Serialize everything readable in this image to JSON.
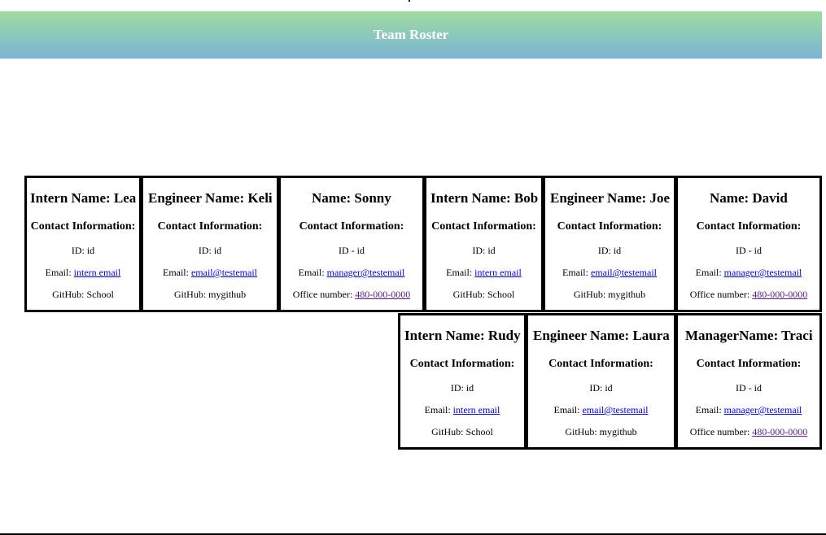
{
  "header": {
    "title": "Team Roster"
  },
  "cards": [
    {
      "title": "Intern Name: Lea",
      "contact_heading": "Contact Information:",
      "id_line": "ID: id",
      "email_label": "Email: ",
      "email_link": "intern email",
      "third_label": "GitHub: School",
      "third_link": ""
    },
    {
      "title": "Engineer Name: Keli",
      "contact_heading": "Contact Information:",
      "id_line": "ID: id",
      "email_label": "Email: ",
      "email_link": "email@testemail",
      "third_label": "GitHub: mygithub",
      "third_link": ""
    },
    {
      "title": "Name: Sonny",
      "contact_heading": "Contact Information:",
      "id_line": "ID - id",
      "email_label": "Email: ",
      "email_link": "manager@testemail",
      "third_label": "Office number: ",
      "third_link": "480-000-0000"
    },
    {
      "title": "Intern Name: Bob",
      "contact_heading": "Contact Information:",
      "id_line": "ID: id",
      "email_label": "Email: ",
      "email_link": "intern email",
      "third_label": "GitHub: School",
      "third_link": ""
    },
    {
      "title": "Engineer Name: Joe",
      "contact_heading": "Contact Information:",
      "id_line": "ID: id",
      "email_label": "Email: ",
      "email_link": "email@testemail",
      "third_label": "GitHub: mygithub",
      "third_link": ""
    },
    {
      "title": "Name: David",
      "contact_heading": "Contact Information:",
      "id_line": "ID - id",
      "email_label": "Email: ",
      "email_link": "manager@testemail",
      "third_label": "Office number: ",
      "third_link": "480-000-0000"
    },
    {
      "title": "Intern Name: Rudy",
      "contact_heading": "Contact Information:",
      "id_line": "ID: id",
      "email_label": "Email: ",
      "email_link": "intern email",
      "third_label": "GitHub: School",
      "third_link": ""
    },
    {
      "title": "Engineer Name: Laura",
      "contact_heading": "Contact Information:",
      "id_line": "ID: id",
      "email_label": "Email: ",
      "email_link": "email@testemail",
      "third_label": "GitHub: mygithub",
      "third_link": ""
    },
    {
      "title": "ManagerName: Traci",
      "contact_heading": "Contact Information:",
      "id_line": "ID - id",
      "email_label": "Email: ",
      "email_link": "manager@testemail",
      "third_label": "Office number: ",
      "third_link": "480-000-0000"
    }
  ]
}
